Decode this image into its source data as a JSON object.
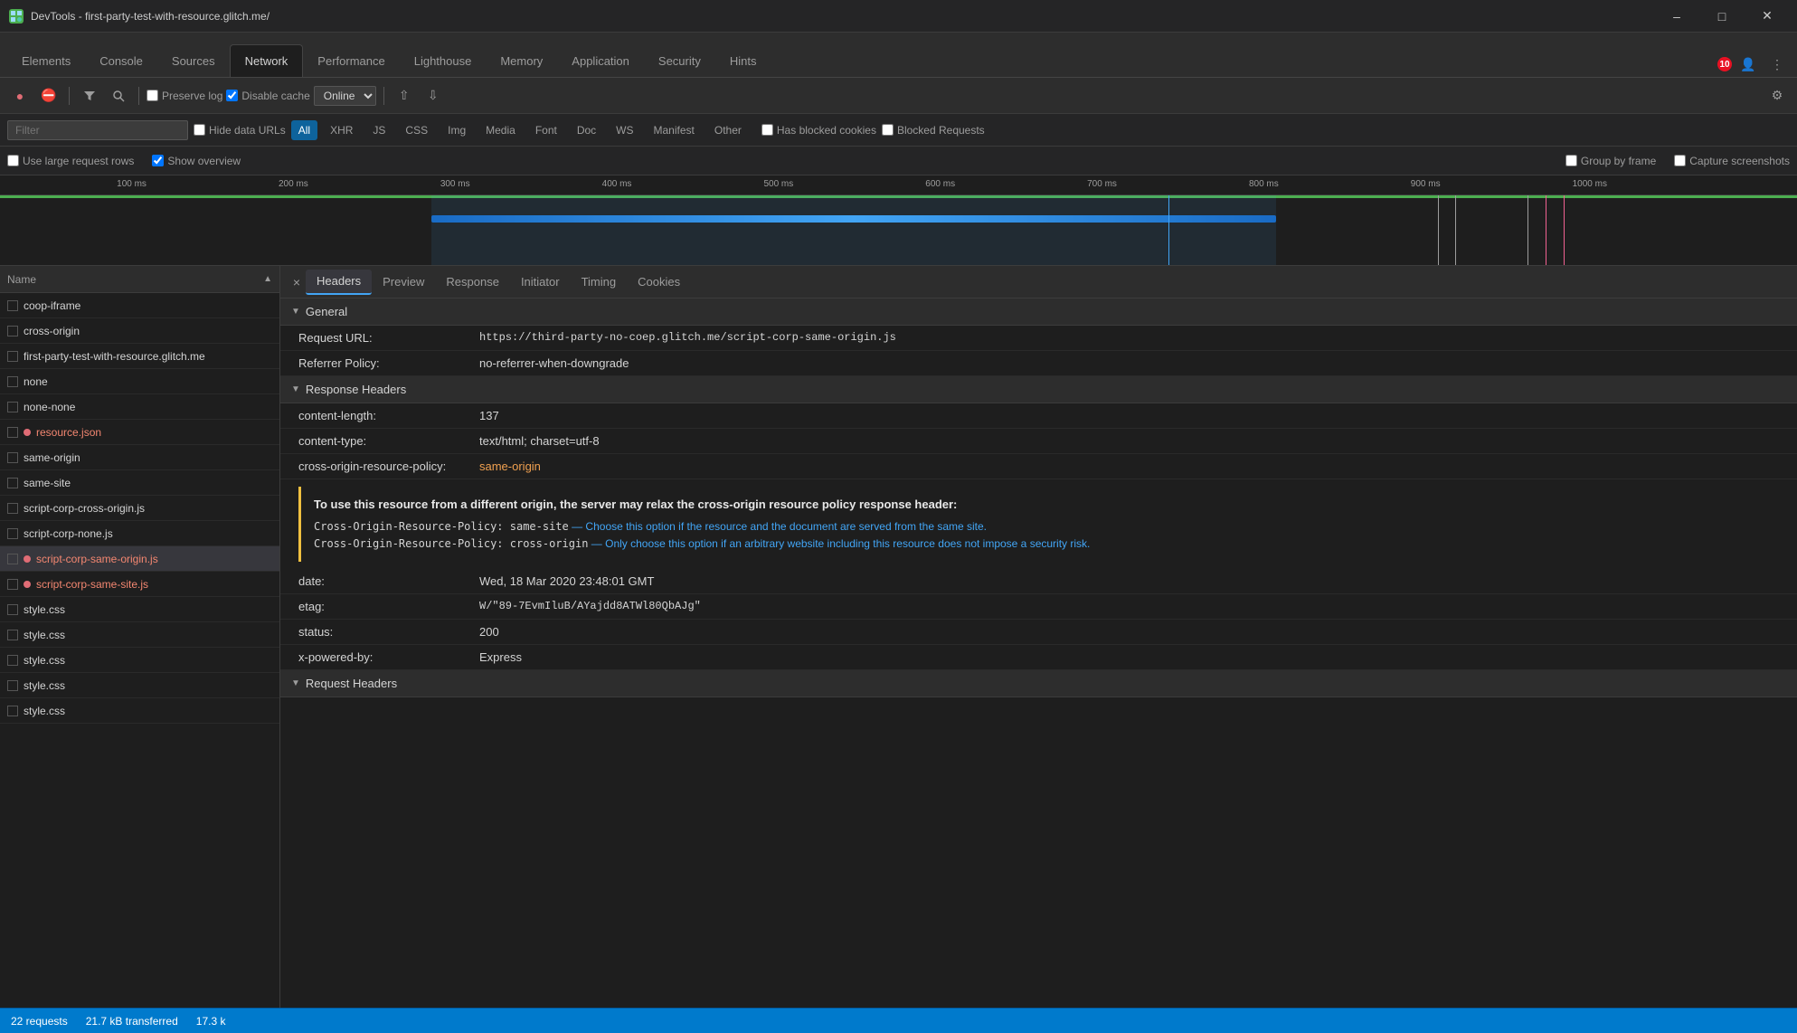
{
  "window": {
    "title": "DevTools - first-party-test-with-resource.glitch.me/",
    "icon": "D"
  },
  "tabs": [
    {
      "label": "Elements",
      "active": false
    },
    {
      "label": "Console",
      "active": false
    },
    {
      "label": "Sources",
      "active": false
    },
    {
      "label": "Network",
      "active": true
    },
    {
      "label": "Performance",
      "active": false
    },
    {
      "label": "Lighthouse",
      "active": false
    },
    {
      "label": "Memory",
      "active": false
    },
    {
      "label": "Application",
      "active": false
    },
    {
      "label": "Security",
      "active": false
    },
    {
      "label": "Hints",
      "active": false
    }
  ],
  "toolbar": {
    "preserve_log": "Preserve log",
    "disable_cache": "Disable cache",
    "throttle": "Online",
    "errors_badge": "10"
  },
  "filter_bar": {
    "placeholder": "Filter",
    "hide_data_urls": "Hide data URLs",
    "all_label": "All",
    "xhr_label": "XHR",
    "js_label": "JS",
    "css_label": "CSS",
    "img_label": "Img",
    "media_label": "Media",
    "font_label": "Font",
    "doc_label": "Doc",
    "ws_label": "WS",
    "manifest_label": "Manifest",
    "other_label": "Other",
    "has_blocked_cookies": "Has blocked cookies",
    "blocked_requests": "Blocked Requests"
  },
  "options": {
    "large_rows": "Use large request rows",
    "show_overview": "Show overview",
    "group_by_frame": "Group by frame",
    "capture_screenshots": "Capture screenshots"
  },
  "timeline": {
    "marks": [
      "100 ms",
      "200 ms",
      "300 ms",
      "400 ms",
      "500 ms",
      "600 ms",
      "700 ms",
      "800 ms",
      "900 ms",
      "1000 ms"
    ]
  },
  "file_list": {
    "column_header": "Name",
    "files": [
      {
        "name": "coop-iframe",
        "red": false,
        "selected": false
      },
      {
        "name": "cross-origin",
        "red": false,
        "selected": false
      },
      {
        "name": "first-party-test-with-resource.glitch.me",
        "red": false,
        "selected": false
      },
      {
        "name": "none",
        "red": false,
        "selected": false
      },
      {
        "name": "none-none",
        "red": false,
        "selected": false
      },
      {
        "name": "resource.json",
        "red": true,
        "selected": false
      },
      {
        "name": "same-origin",
        "red": false,
        "selected": false
      },
      {
        "name": "same-site",
        "red": false,
        "selected": false
      },
      {
        "name": "script-corp-cross-origin.js",
        "red": false,
        "selected": false
      },
      {
        "name": "script-corp-none.js",
        "red": false,
        "selected": false
      },
      {
        "name": "script-corp-same-origin.js",
        "red": true,
        "selected": true,
        "highlighted": true
      },
      {
        "name": "script-corp-same-site.js",
        "red": true,
        "selected": false
      },
      {
        "name": "style.css",
        "red": false,
        "selected": false
      },
      {
        "name": "style.css",
        "red": false,
        "selected": false
      },
      {
        "name": "style.css",
        "red": false,
        "selected": false
      },
      {
        "name": "style.css",
        "red": false,
        "selected": false
      },
      {
        "name": "style.css",
        "red": false,
        "selected": false
      }
    ]
  },
  "headers_panel": {
    "close_label": "×",
    "tabs": [
      {
        "label": "Headers",
        "active": true
      },
      {
        "label": "Preview",
        "active": false
      },
      {
        "label": "Response",
        "active": false
      },
      {
        "label": "Initiator",
        "active": false
      },
      {
        "label": "Timing",
        "active": false
      },
      {
        "label": "Cookies",
        "active": false
      }
    ],
    "general_section": {
      "title": "General",
      "request_url_key": "Request URL:",
      "request_url_val": "https://third-party-no-coep.glitch.me/script-corp-same-origin.js",
      "referrer_policy_key": "Referrer Policy:",
      "referrer_policy_val": "no-referrer-when-downgrade"
    },
    "response_headers_section": {
      "title": "Response Headers",
      "headers": [
        {
          "key": "content-length:",
          "val": "137"
        },
        {
          "key": "content-type:",
          "val": "text/html; charset=utf-8"
        },
        {
          "key": "cross-origin-resource-policy:",
          "val": "same-origin",
          "val_orange": true
        }
      ],
      "warning": {
        "title": "To use this resource from a different origin, the server may relax the cross-origin resource policy response header:",
        "line1_code": "Cross-Origin-Resource-Policy: same-site",
        "line1_desc": " — Choose this option if the resource and the document are served from the same site.",
        "line2_code": "Cross-Origin-Resource-Policy: cross-origin",
        "line2_desc": " — Only choose this option if an arbitrary website including this resource does not impose a security risk."
      },
      "more_headers": [
        {
          "key": "date:",
          "val": "Wed, 18 Mar 2020 23:48:01 GMT"
        },
        {
          "key": "etag:",
          "val": "W/\"89-7EvmIluB/AYajdd8ATWl80QbAJg\""
        },
        {
          "key": "status:",
          "val": "200"
        },
        {
          "key": "x-powered-by:",
          "val": "Express"
        }
      ]
    },
    "request_headers_section": {
      "title": "Request Headers"
    }
  },
  "status_bar": {
    "requests": "22 requests",
    "transferred": "21.7 kB transferred",
    "size": "17.3 k"
  }
}
